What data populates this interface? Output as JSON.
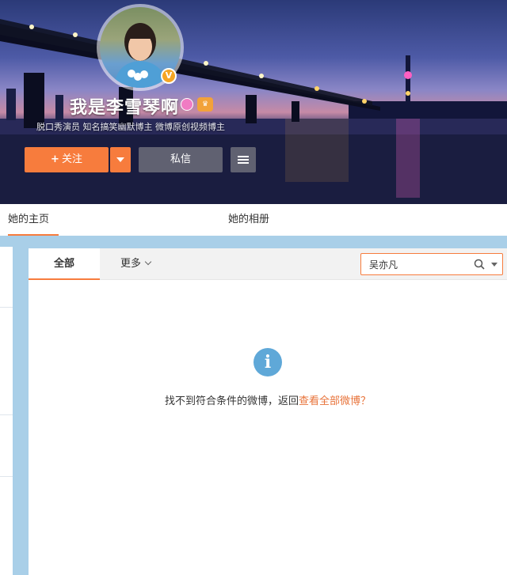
{
  "profile": {
    "name": "我是李雪琴啊",
    "verified_badge": "V",
    "gender_icon": "female-icon",
    "level_badge": "lv-icon",
    "description": "脱口秀演员 知名搞笑幽默博主 微博原创视频博主"
  },
  "actions": {
    "follow_plus": "+",
    "follow_label": "关注",
    "message_label": "私信"
  },
  "tabs": {
    "home": "她的主页",
    "album": "她的相册"
  },
  "filter": {
    "all": "全部",
    "more": "更多",
    "search_value": "吴亦凡"
  },
  "empty": {
    "message": "找不到符合条件的微博，返回",
    "link": "查看全部微博？"
  },
  "colors": {
    "accent": "#f77c3d",
    "info": "#5fa8d8",
    "body_bg": "#a9cfe8"
  }
}
